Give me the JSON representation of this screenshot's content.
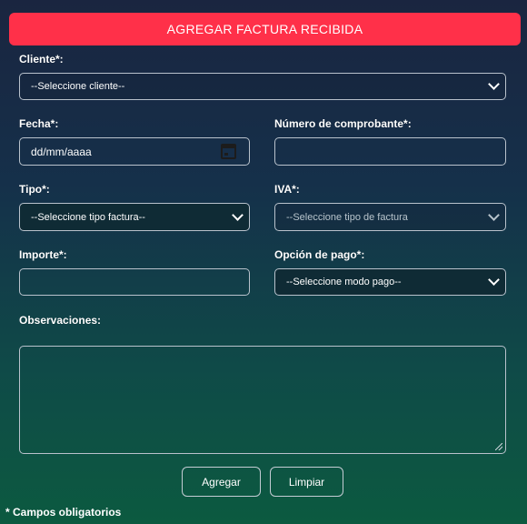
{
  "form": {
    "title": "AGREGAR FACTURA RECIBIDA",
    "cliente": {
      "label": "Cliente*:",
      "value": "--Seleccione cliente--"
    },
    "fecha": {
      "label": "Fecha*:",
      "value": "dd/mm/aaaa"
    },
    "numero": {
      "label": "Número de comprobante*:",
      "value": ""
    },
    "tipo": {
      "label": "Tipo*:",
      "value": "--Seleccione tipo factura--"
    },
    "iva": {
      "label": "IVA*:",
      "value": "--Seleccione tipo de factura"
    },
    "importe": {
      "label": "Importe*:",
      "value": ""
    },
    "pago": {
      "label": "Opción de pago*:",
      "value": "--Seleccione modo pago--"
    },
    "observaciones": {
      "label": "Observaciones:",
      "value": ""
    },
    "buttons": {
      "agregar": "Agregar",
      "limpiar": "Limpiar"
    },
    "footnote": "* Campos obligatorios"
  },
  "colors": {
    "accent": "#ff3049"
  },
  "icons": {
    "date": "calendar-icon",
    "dropdown": "chevron-down-icon"
  }
}
